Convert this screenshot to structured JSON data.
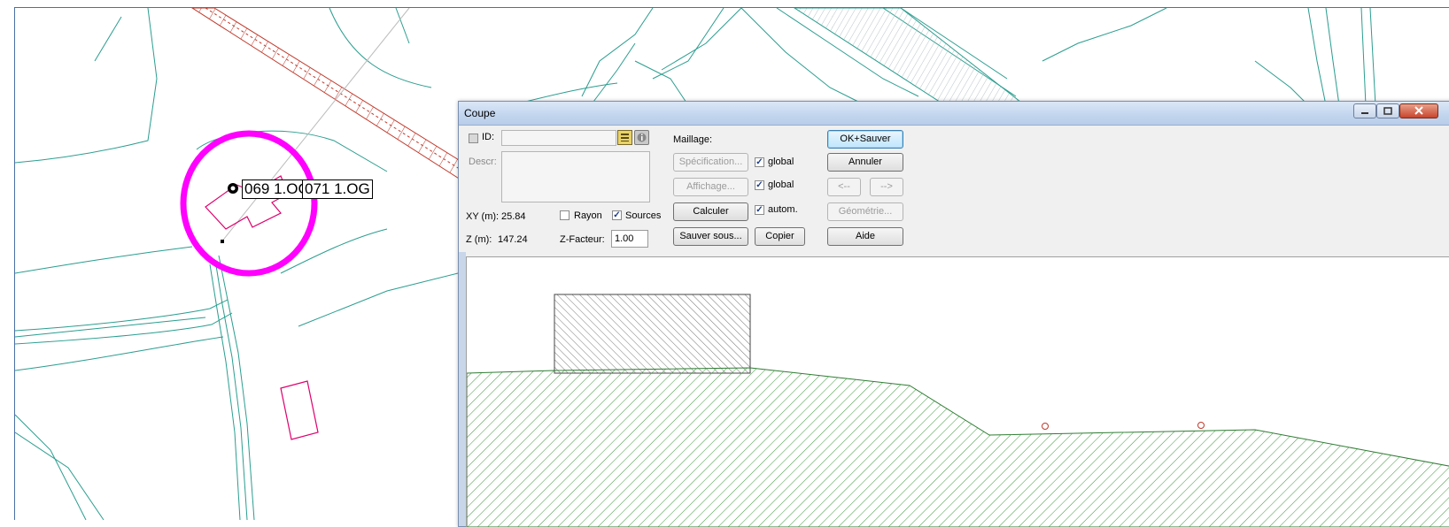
{
  "map": {
    "labels": [
      "069 1.OG",
      "071 1.OG"
    ]
  },
  "dialog": {
    "title": "Coupe",
    "id_label": "ID:",
    "id_value": "",
    "descr_label": "Descr:",
    "descr_value": "",
    "maillage_label": "Maillage:",
    "specification_button": "Spécification...",
    "affichage_button": "Affichage...",
    "calculer_button": "Calculer",
    "sauver_sous_button": "Sauver sous...",
    "copier_button": "Copier",
    "global_label_1": "global",
    "global_label_2": "global",
    "autom_label": "autom.",
    "global_1_checked": true,
    "global_2_checked": true,
    "autom_checked": true,
    "xy_label": "XY (m):",
    "xy_value": "25.84",
    "z_label": "Z (m):",
    "z_value": "147.24",
    "rayon_label": "Rayon",
    "rayon_checked": false,
    "sources_label": "Sources",
    "sources_checked": true,
    "zfacteur_label": "Z-Facteur:",
    "zfacteur_value": "1.00",
    "ok_sauver_button": "OK+Sauver",
    "annuler_button": "Annuler",
    "prev_button": "<--",
    "next_button": "-->",
    "geometrie_button": "Géométrie...",
    "aide_button": "Aide"
  },
  "colors": {
    "map_lines": "#2a9d8f",
    "building_outline": "#e0006e",
    "highlight_circle": "#ff00ff",
    "rail_hatch": "#c0392b",
    "terrain_hatch": "#3c9a3c",
    "receiver": "#c0392b"
  }
}
